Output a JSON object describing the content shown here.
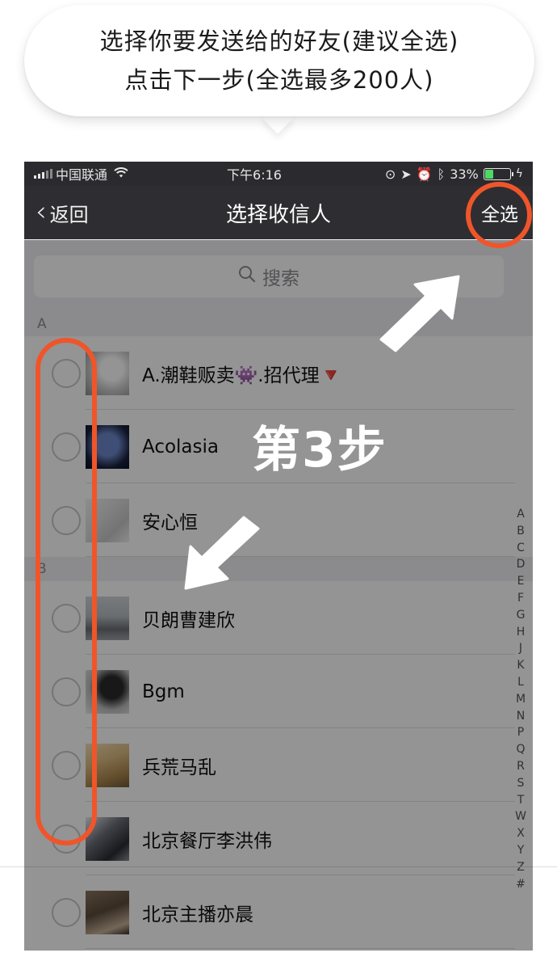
{
  "instruction": {
    "line1": "选择你要发送给的好友(建议全选)",
    "line2": "点击下一步(全选最多200人)"
  },
  "status_bar": {
    "carrier": "中国联通",
    "time": "下午6:16",
    "battery_percent": "33%",
    "battery_level": 0.33
  },
  "nav": {
    "back_label": "返回",
    "title": "选择收信人",
    "select_all_label": "全选"
  },
  "search": {
    "placeholder": "搜索"
  },
  "sections": [
    {
      "header": "A",
      "contacts": [
        {
          "name": "A.潮鞋贩卖👾.招代理🔻"
        },
        {
          "name": "Acolasia"
        },
        {
          "name": "安心恒"
        }
      ]
    },
    {
      "header": "B",
      "contacts": [
        {
          "name": "贝朗曹建欣"
        },
        {
          "name": "Bgm"
        },
        {
          "name": "兵荒马乱"
        },
        {
          "name": "北京餐厅李洪伟"
        },
        {
          "name": "北京主播亦晨"
        }
      ]
    }
  ],
  "index_letters": [
    "A",
    "B",
    "C",
    "D",
    "E",
    "F",
    "G",
    "H",
    "J",
    "K",
    "L",
    "M",
    "N",
    "P",
    "Q",
    "R",
    "S",
    "T",
    "W",
    "X",
    "Y",
    "Z",
    "#"
  ],
  "annotation": {
    "step_label": "第3步",
    "highlight_color": "#f0552a"
  }
}
